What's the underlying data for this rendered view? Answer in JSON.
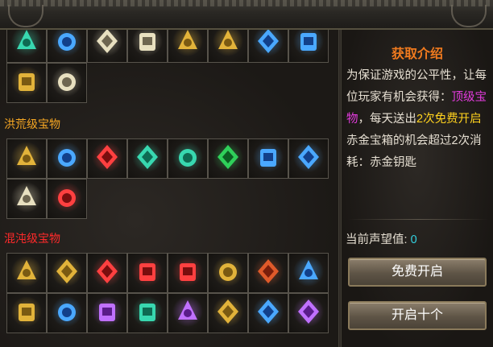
{
  "sections": [
    {
      "title": "",
      "color": "#f5a623",
      "items": [
        "green-flame-gem",
        "gold-pouch",
        "gold-treasure-chest",
        "gold-armor",
        "winged-helmet",
        "red-orb-ring",
        "spear",
        "gold-pendant",
        "blue-dragon-flame",
        "golden-crest"
      ]
    },
    {
      "title": "洪荒级宝物",
      "color": "#f5a623",
      "items": [
        "green-dragon-ball",
        "golden-egg",
        "winged-sword",
        "red-fire-orb",
        "dark-throne",
        "purple-claw",
        "demon-warrior",
        "fire-serpent",
        "golden-temple",
        "golden-shrine"
      ]
    },
    {
      "title": "混沌级宝物",
      "color": "#ff2a2a",
      "items": [
        "crown-jar",
        "dark-bow",
        "crystal-mace",
        "golden-claw",
        "jade-tower",
        "skull-mirror",
        "green-pagoda",
        "horned-skull",
        "blood-eye",
        "green-vial",
        "tiger-mask",
        "stone-tablet",
        "green-beast-mask",
        "purple-wings",
        "golden-dragon",
        "flaming-staff"
      ]
    }
  ],
  "panel": {
    "title": "获取介绍",
    "desc": {
      "p1": "为保证游戏的公平性，让每位玩家有机会获得：",
      "p2": "顶级宝物",
      "p3": "，每天送出",
      "p4": "2次免费开启",
      "p5": "赤金宝箱的机会超过2次消耗：赤金钥匙"
    },
    "reputation_label": "当前声望值:",
    "reputation_value": "0",
    "free_open": "免费开启",
    "open_ten": "开启十个"
  }
}
